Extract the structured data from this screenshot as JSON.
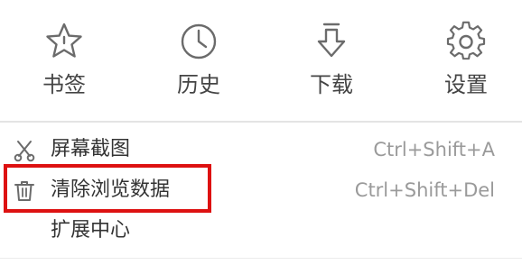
{
  "toolbar": {
    "items": [
      {
        "label": "书签",
        "icon": "star-icon"
      },
      {
        "label": "历史",
        "icon": "clock-icon"
      },
      {
        "label": "下载",
        "icon": "download-icon"
      },
      {
        "label": "设置",
        "icon": "gear-icon"
      }
    ]
  },
  "menu": {
    "items": [
      {
        "label": "屏幕截图",
        "shortcut": "Ctrl+Shift+A",
        "icon": "scissors-icon"
      },
      {
        "label": "清除浏览数据",
        "shortcut": "Ctrl+Shift+Del",
        "icon": "trash-icon"
      },
      {
        "label": "扩展中心",
        "shortcut": ""
      }
    ]
  },
  "colors": {
    "highlight": "#dd1111",
    "icon_stroke": "#6b6b6b",
    "shortcut_text": "#9a9a9a"
  }
}
